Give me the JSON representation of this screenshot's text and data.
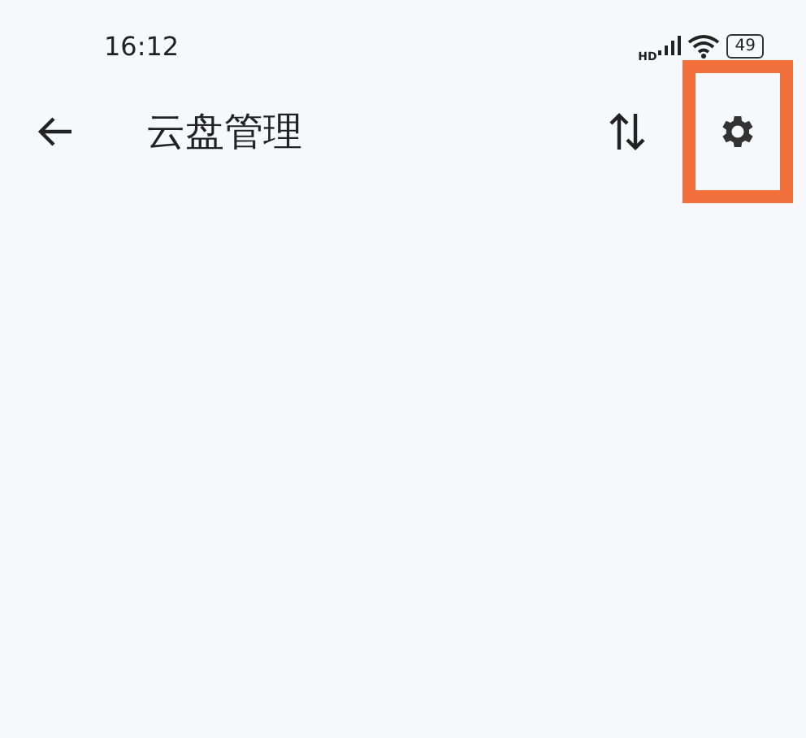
{
  "status_bar": {
    "time": "16:12",
    "network_label": "HD",
    "battery": "49"
  },
  "toolbar": {
    "title": "云盘管理",
    "actions": [
      {
        "kind": "sort",
        "highlighted": false
      },
      {
        "kind": "settings",
        "highlighted": true
      }
    ]
  }
}
